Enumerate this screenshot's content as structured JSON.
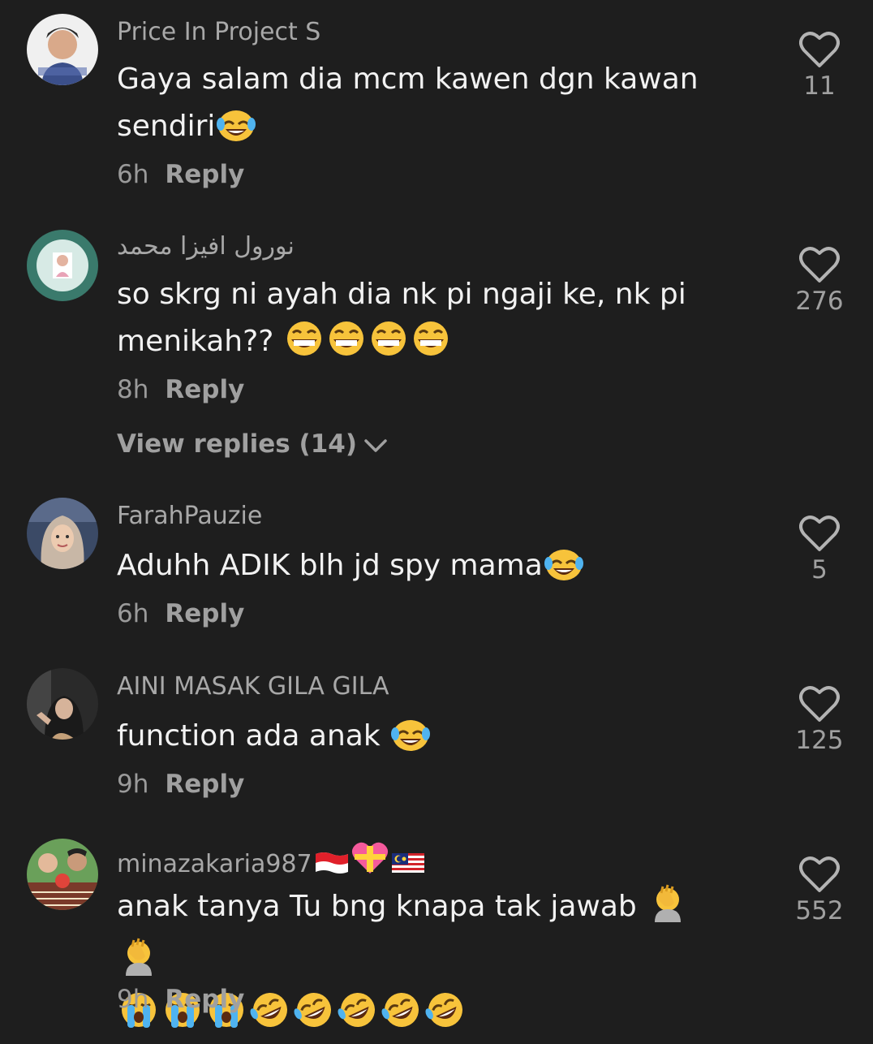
{
  "comments": [
    {
      "username": "Price In Project S",
      "text": "Gaya salam dia mcm kawen dgn kawan sendiri",
      "emojis": [
        "laughing-tears"
      ],
      "time": "6h",
      "reply_label": "Reply",
      "likes": "11",
      "avatar_icon": "avatar-man-photo"
    },
    {
      "username": "نورول افيزا محمد",
      "text": "so skrg ni ayah dia nk pi ngaji ke, nk pi menikah??",
      "emojis": [
        "grinning",
        "grinning",
        "grinning",
        "grinning"
      ],
      "time": "8h",
      "reply_label": "Reply",
      "likes": "276",
      "avatar_icon": "avatar-girl-teal-ring",
      "view_replies": "View replies (14)"
    },
    {
      "username": "FarahPauzie",
      "text": "Aduhh ADIK blh jd spy mama",
      "emojis": [
        "laughing-tears"
      ],
      "time": "6h",
      "reply_label": "Reply",
      "likes": "5",
      "avatar_icon": "avatar-woman-hijab"
    },
    {
      "username": "AINI MASAK GILA GILA",
      "text": "function ada anak",
      "emojis": [
        "laughing-tears"
      ],
      "time": "9h",
      "reply_label": "Reply",
      "likes": "125",
      "avatar_icon": "avatar-woman-dark"
    },
    {
      "username": "minazakaria987",
      "username_emojis": [
        "indonesia-flag",
        "heart-gift",
        "malaysia-flag"
      ],
      "text": "anak tanya Tu bng knapa tak jawab",
      "emojis": [
        "facepalm",
        "facepalm",
        "loudly-crying",
        "loudly-crying",
        "loudly-crying",
        "rofl",
        "rofl",
        "rofl",
        "rofl",
        "rofl"
      ],
      "time": "9h",
      "reply_label": "Reply",
      "likes": "552",
      "avatar_icon": "avatar-couple-photo"
    }
  ],
  "colors": {
    "background": "#1e1e1e",
    "username": "#a8a8a8",
    "text": "#f2f2f2",
    "meta": "#9a9a9a"
  }
}
